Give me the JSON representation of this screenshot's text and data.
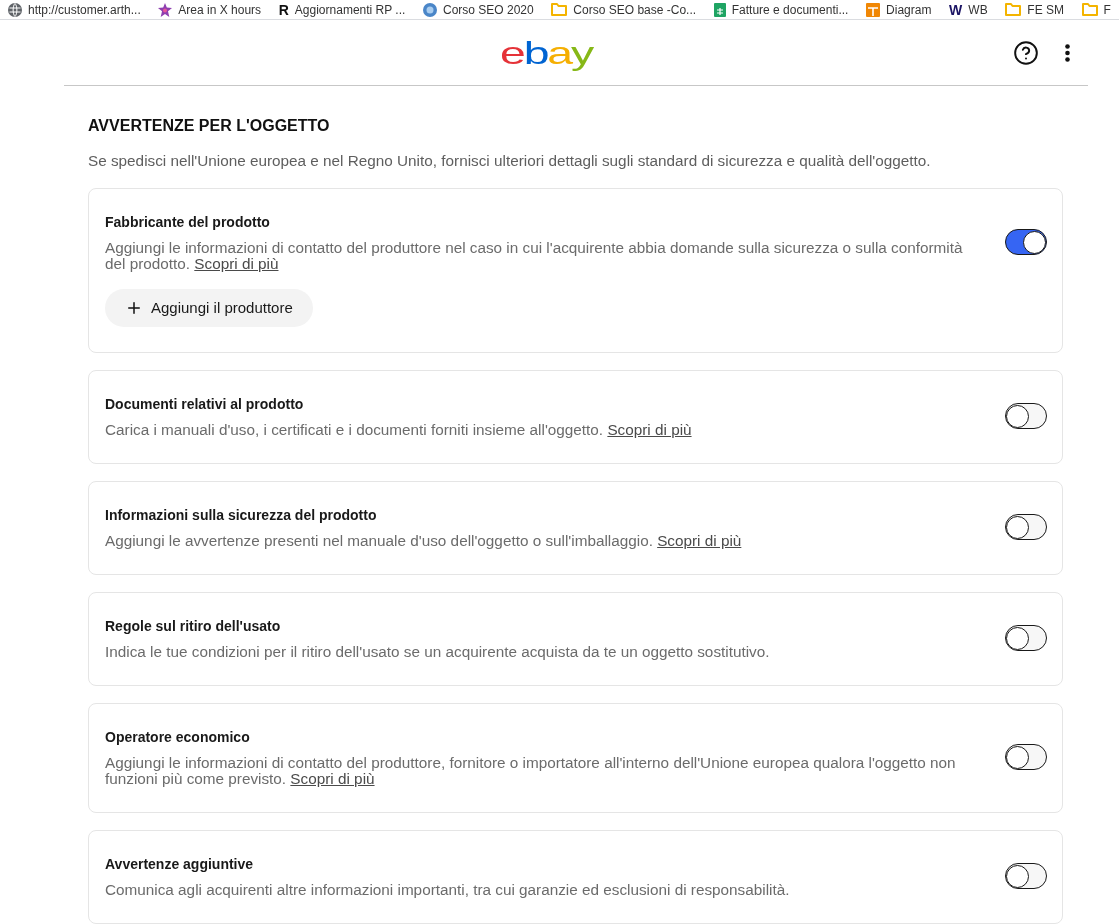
{
  "bookmarks": [
    {
      "kind": "globe",
      "label": "http://customer.arth..."
    },
    {
      "kind": "star",
      "label": "Area in X hours"
    },
    {
      "kind": "letter",
      "icon_char": "R",
      "color": "#111111",
      "label": "Aggiornamenti RP ..."
    },
    {
      "kind": "circle",
      "label": "Corso SEO 2020"
    },
    {
      "kind": "folder",
      "label": "Corso SEO base -Co..."
    },
    {
      "kind": "sheets",
      "label": "Fatture e documenti..."
    },
    {
      "kind": "diagram",
      "label": "Diagram"
    },
    {
      "kind": "letter",
      "icon_char": "W",
      "color": "#1b1464",
      "label": "WB"
    },
    {
      "kind": "folder",
      "label": "FE SM"
    },
    {
      "kind": "folder",
      "label": "F"
    }
  ],
  "header": {
    "logo": [
      {
        "char": "e",
        "color": "#e53238"
      },
      {
        "char": "b",
        "color": "#0064d2"
      },
      {
        "char": "a",
        "color": "#f5af02"
      },
      {
        "char": "y",
        "color": "#86b817"
      }
    ]
  },
  "section": {
    "title": "AVVERTENZE PER L'OGGETTO",
    "subtitle": "Se spedisci nell'Unione europea e nel Regno Unito, fornisci ulteriori dettagli sugli standard di sicurezza e qualità dell'oggetto.",
    "cards": [
      {
        "title": "Fabbricante del prodotto",
        "description": "Aggiungi le informazioni di contatto del produttore nel caso in cui l'acquirente abbia domande sulla sicurezza o sulla conformità del prodotto.",
        "link": "Scopri di più",
        "on": true,
        "action": "Aggiungi il produttore"
      },
      {
        "title": "Documenti relativi al prodotto",
        "description": "Carica i manuali d'uso, i certificati e i documenti forniti insieme all'oggetto.",
        "link": "Scopri di più",
        "on": false
      },
      {
        "title": "Informazioni sulla sicurezza del prodotto",
        "description": "Aggiungi le avvertenze presenti nel manuale d'uso dell'oggetto o sull'imballaggio.",
        "link": "Scopri di più",
        "on": false
      },
      {
        "title": "Regole sul ritiro dell'usato",
        "description": "Indica le tue condizioni per il ritiro dell'usato se un acquirente acquista da te un oggetto sostitutivo.",
        "on": false
      },
      {
        "title": "Operatore economico",
        "description": "Aggiungi le informazioni di contatto del produttore, fornitore o importatore all'interno dell'Unione europea qualora l'oggetto non funzioni più come previsto.",
        "link": "Scopri di più",
        "on": false
      },
      {
        "title": "Avvertenze aggiuntive",
        "description": "Comunica agli acquirenti altre informazioni importanti, tra cui garanzie ed esclusioni di responsabilità.",
        "on": false
      }
    ]
  }
}
